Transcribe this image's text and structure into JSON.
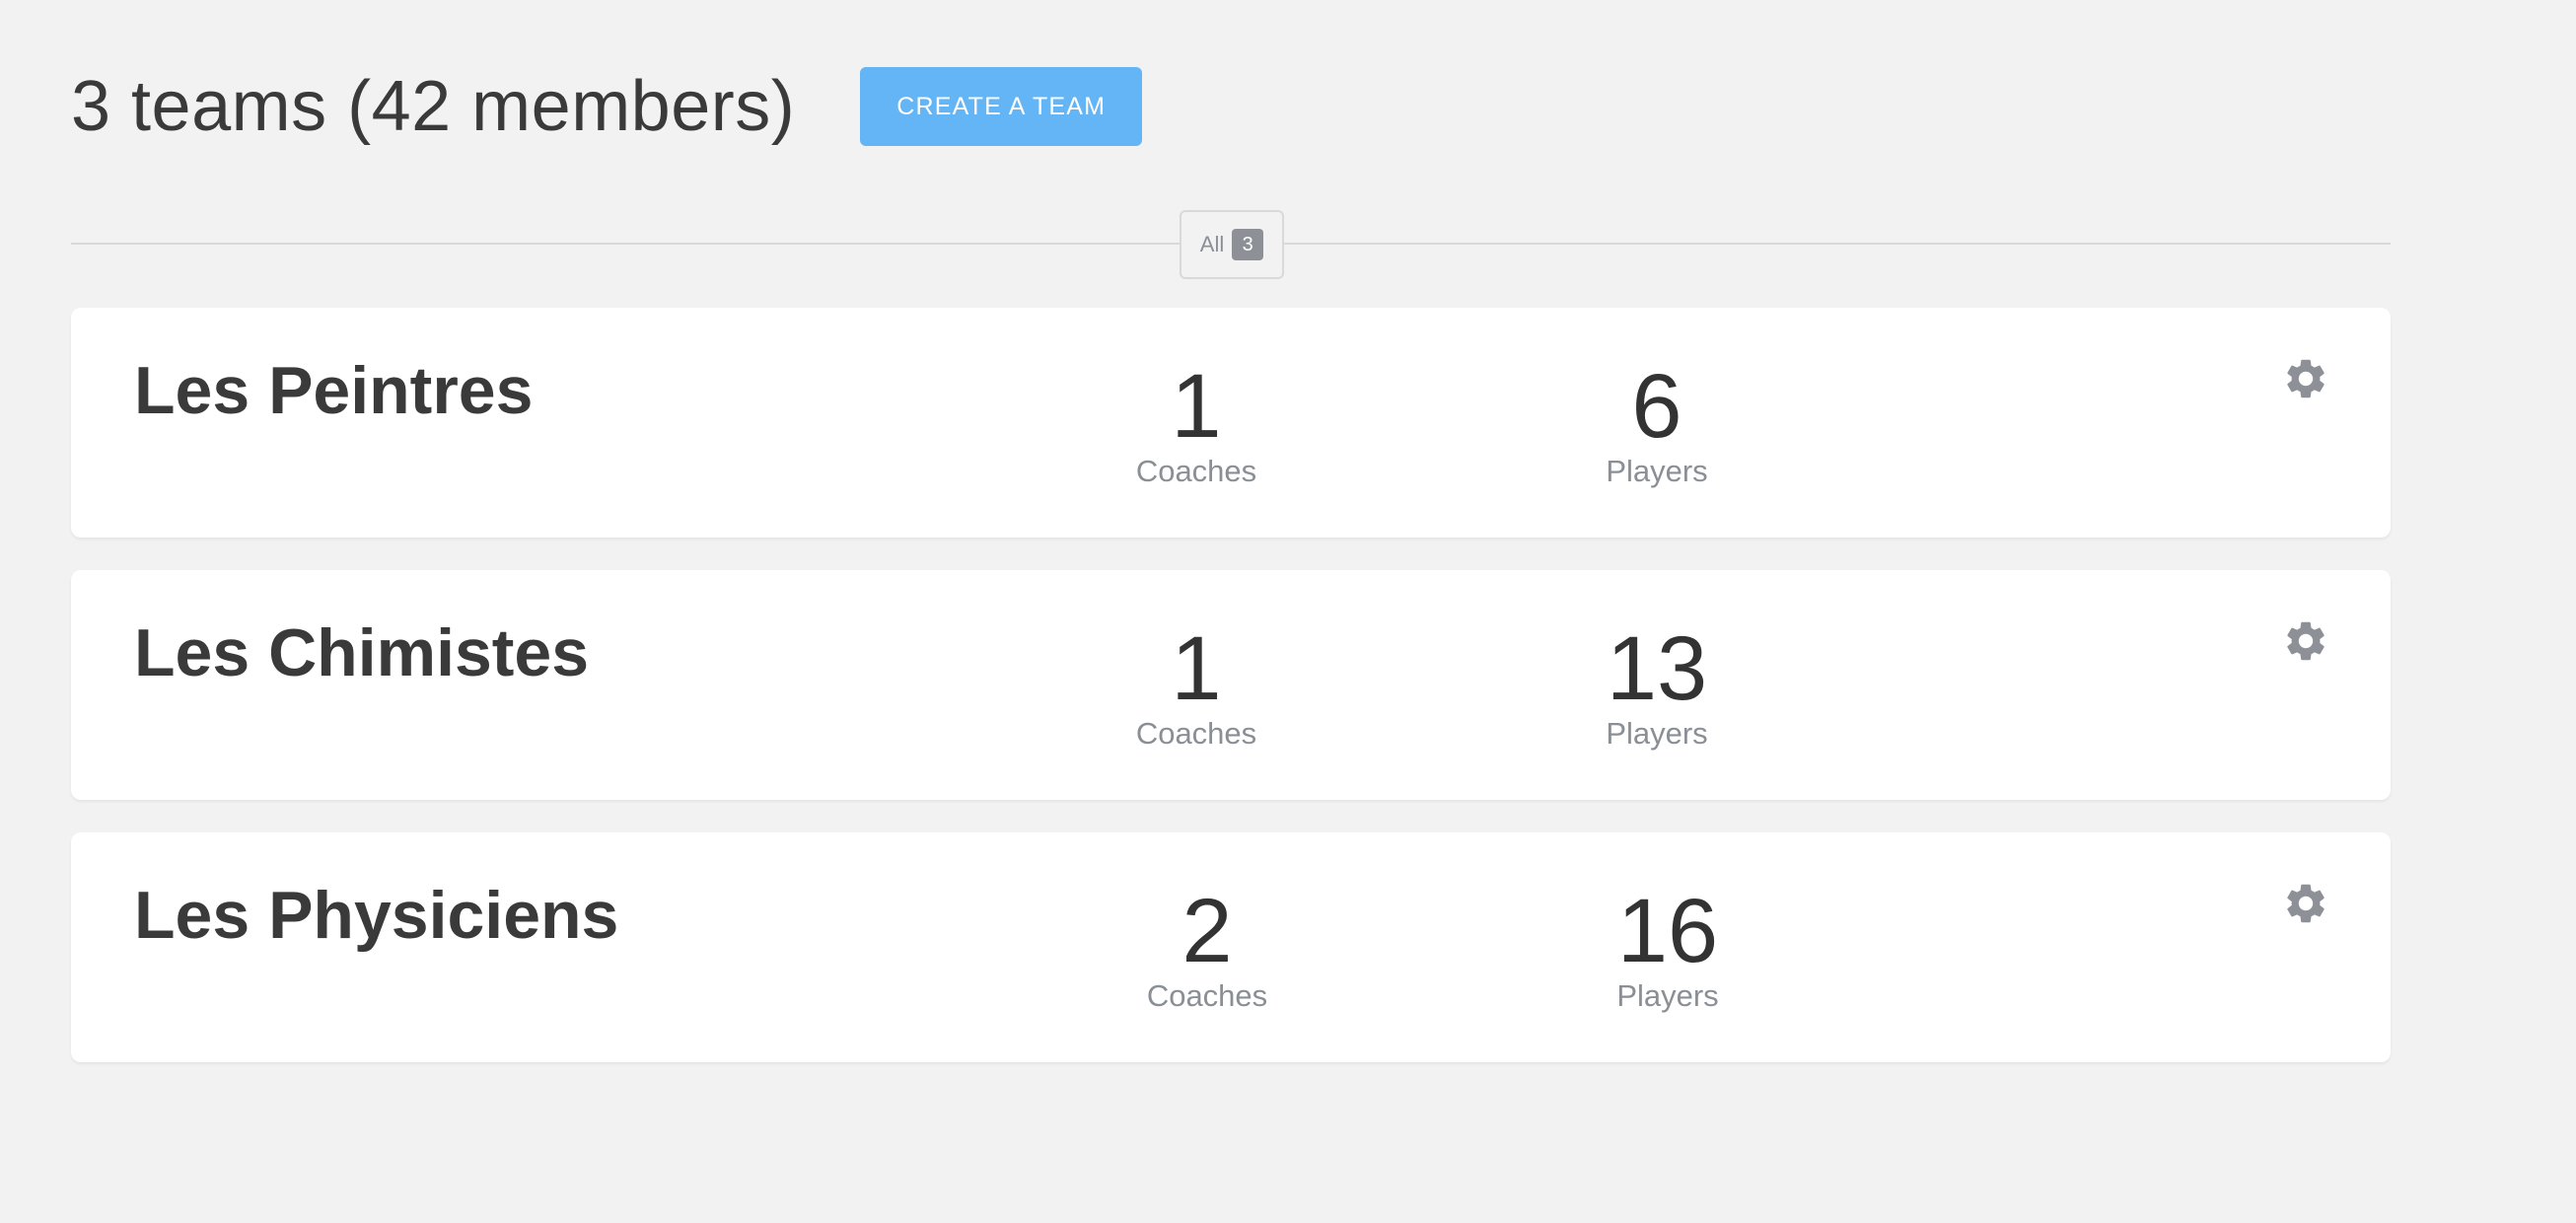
{
  "header": {
    "title": "3 teams (42 members)",
    "create_button": "CREATE A TEAM"
  },
  "filter": {
    "label": "All",
    "count": "3"
  },
  "teams": [
    {
      "name": "Les Peintres",
      "coaches": "1",
      "coaches_label": "Coaches",
      "players": "6",
      "players_label": "Players"
    },
    {
      "name": "Les Chimistes",
      "coaches": "1",
      "coaches_label": "Coaches",
      "players": "13",
      "players_label": "Players"
    },
    {
      "name": "Les Physiciens",
      "coaches": "2",
      "coaches_label": "Coaches",
      "players": "16",
      "players_label": "Players"
    }
  ],
  "icons": {
    "settings": "gear-icon"
  },
  "colors": {
    "accent": "#64b5f6",
    "background": "#f2f2f2",
    "muted_text": "#8a8f96",
    "icon": "#8d9197"
  }
}
